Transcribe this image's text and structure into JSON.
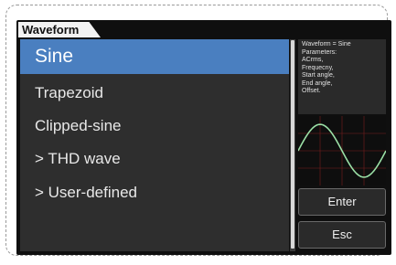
{
  "tab": {
    "label": "Waveform"
  },
  "menu": {
    "items": [
      {
        "label": "Sine",
        "selected": true
      },
      {
        "label": "Trapezoid",
        "selected": false
      },
      {
        "label": "Clipped-sine",
        "selected": false
      },
      {
        "label": "> THD wave",
        "selected": false
      },
      {
        "label": "> User-defined",
        "selected": false
      }
    ]
  },
  "info": {
    "lines": [
      "Waveform = Sine",
      "Parameters:",
      "ACrms,",
      "Frequecny,",
      "Start angle,",
      "End angle,",
      "Offset."
    ]
  },
  "preview": {
    "icon": "sine-wave-preview",
    "wave_color": "#9be0a6",
    "grid_color": "#7a1e1e"
  },
  "buttons": {
    "enter_label": "Enter",
    "esc_label": "Esc"
  },
  "colors": {
    "accent": "#4a7fc0",
    "panel": "#2e2e2e",
    "screen": "#0f0f0f"
  }
}
